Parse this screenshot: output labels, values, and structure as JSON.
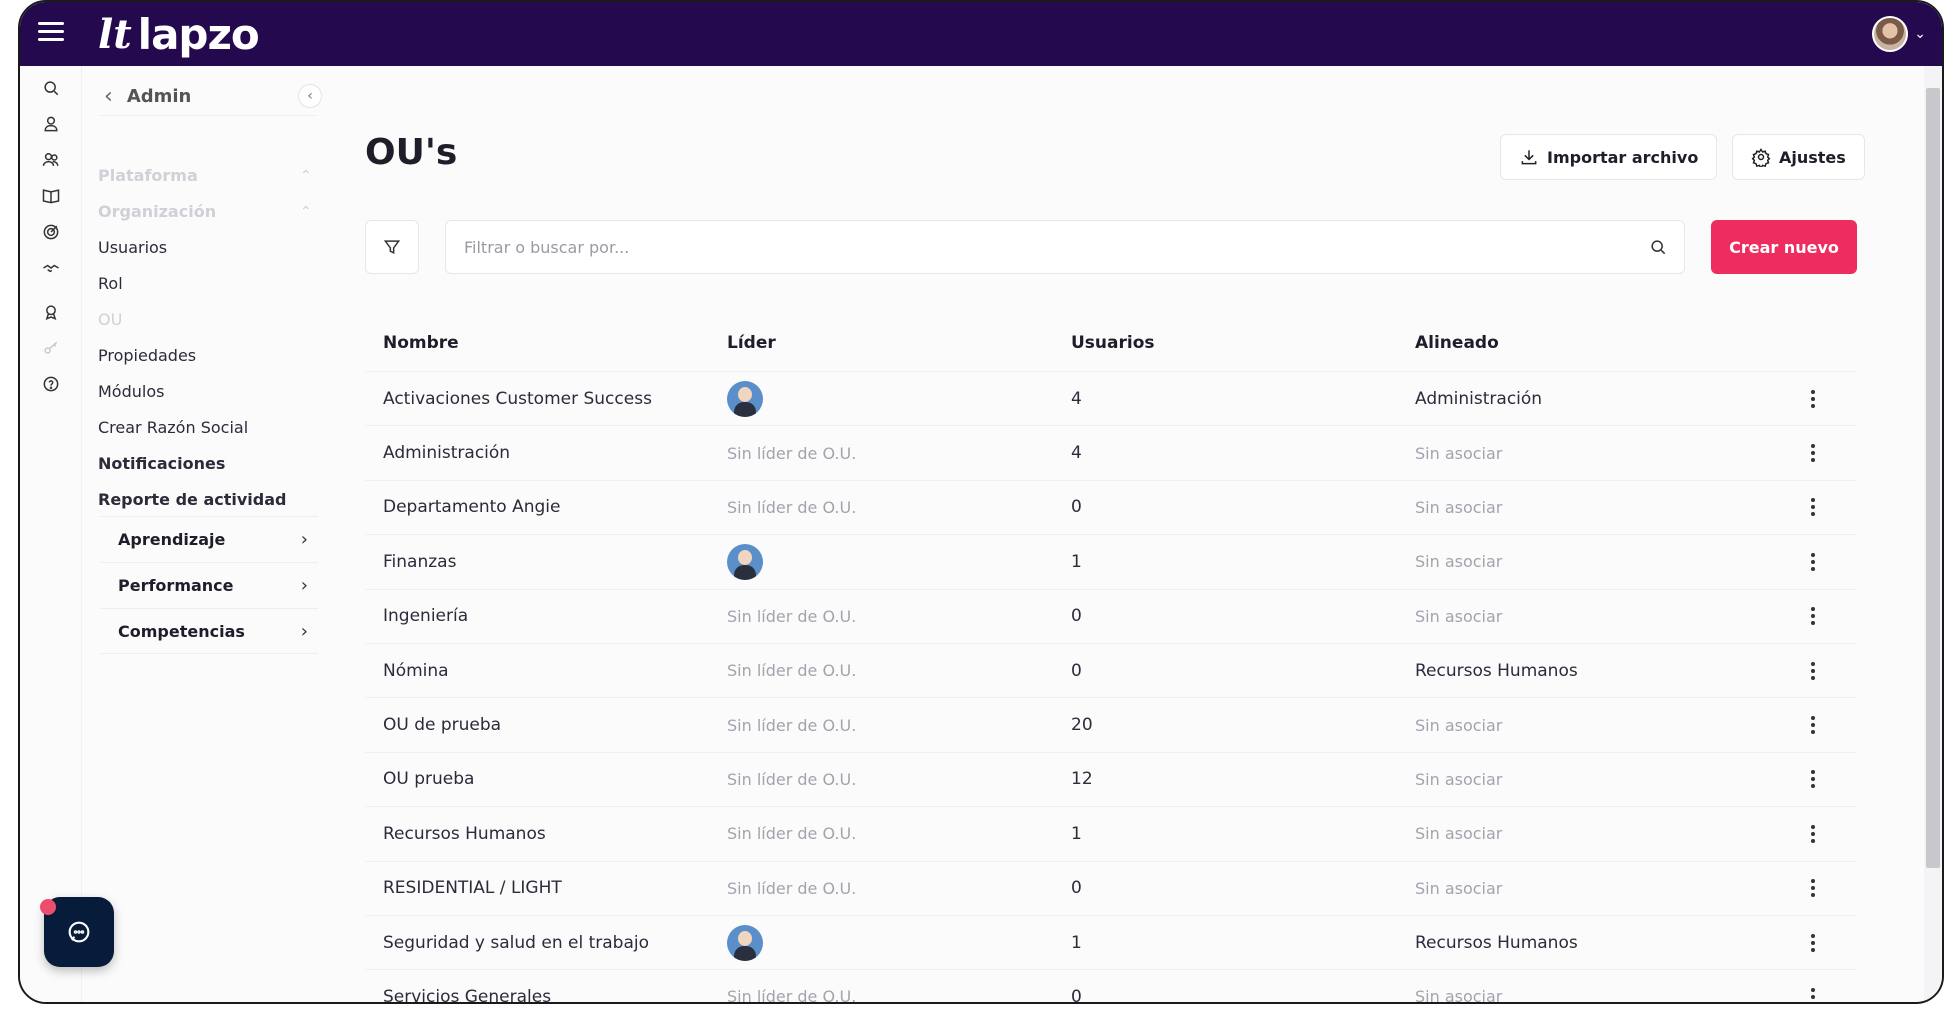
{
  "app": {
    "logo_text": "lapzo",
    "logo_mark": "lt"
  },
  "sidebar": {
    "title": "Admin",
    "sections": [
      {
        "label": "Plataforma",
        "state": "expanded"
      },
      {
        "label": "Organización",
        "state": "expanded"
      }
    ],
    "items": [
      {
        "label": "Usuarios"
      },
      {
        "label": "Rol"
      },
      {
        "label": "OU",
        "active": true
      },
      {
        "label": "Propiedades"
      },
      {
        "label": "Módulos"
      },
      {
        "label": "Crear Razón Social"
      },
      {
        "label": "Notificaciones"
      },
      {
        "label": "Reporte de actividad"
      }
    ],
    "groups": [
      {
        "label": "Aprendizaje"
      },
      {
        "label": "Performance"
      },
      {
        "label": "Competencias"
      }
    ]
  },
  "rail_icons": [
    "search-icon",
    "user-icon",
    "users-icon",
    "book-icon",
    "target-icon",
    "handshake-icon",
    "award-icon",
    "key-icon",
    "help-icon"
  ],
  "page": {
    "title": "OU's",
    "import_label": "Importar archivo",
    "settings_label": "Ajustes",
    "search_placeholder": "Filtrar o buscar por...",
    "create_label": "Crear nuevo"
  },
  "table": {
    "headers": [
      "Nombre",
      "Líder",
      "Usuarios",
      "Alineado"
    ],
    "rows": [
      {
        "name": "Activaciones Customer Success",
        "leader": "",
        "has_leader": true,
        "users": "4",
        "aligned": "Administración",
        "aligned_muted": false
      },
      {
        "name": "Administración",
        "leader": "Sin líder de O.U.",
        "has_leader": false,
        "users": "4",
        "aligned": "Sin asociar",
        "aligned_muted": true
      },
      {
        "name": "Departamento Angie",
        "leader": "Sin líder de O.U.",
        "has_leader": false,
        "users": "0",
        "aligned": "Sin asociar",
        "aligned_muted": true
      },
      {
        "name": "Finanzas",
        "leader": "",
        "has_leader": true,
        "users": "1",
        "aligned": "Sin asociar",
        "aligned_muted": true
      },
      {
        "name": "Ingeniería",
        "leader": "Sin líder de O.U.",
        "has_leader": false,
        "users": "0",
        "aligned": "Sin asociar",
        "aligned_muted": true
      },
      {
        "name": "Nómina",
        "leader": "Sin líder de O.U.",
        "has_leader": false,
        "users": "0",
        "aligned": "Recursos Humanos",
        "aligned_muted": false
      },
      {
        "name": "OU de prueba",
        "leader": "Sin líder de O.U.",
        "has_leader": false,
        "users": "20",
        "aligned": "Sin asociar",
        "aligned_muted": true
      },
      {
        "name": "OU prueba",
        "leader": "Sin líder de O.U.",
        "has_leader": false,
        "users": "12",
        "aligned": "Sin asociar",
        "aligned_muted": true
      },
      {
        "name": "Recursos Humanos",
        "leader": "Sin líder de O.U.",
        "has_leader": false,
        "users": "1",
        "aligned": "Sin asociar",
        "aligned_muted": true
      },
      {
        "name": "RESIDENTIAL / LIGHT",
        "leader": "Sin líder de O.U.",
        "has_leader": false,
        "users": "0",
        "aligned": "Sin asociar",
        "aligned_muted": true
      },
      {
        "name": "Seguridad y salud en el trabajo",
        "leader": "",
        "has_leader": true,
        "users": "1",
        "aligned": "Recursos Humanos",
        "aligned_muted": false
      },
      {
        "name": "Servicios Generales",
        "leader": "Sin líder de O.U.",
        "has_leader": false,
        "users": "0",
        "aligned": "Sin asociar",
        "aligned_muted": true
      }
    ]
  },
  "colors": {
    "topbar": "#24094e",
    "primary": "#ee2c5e",
    "chat": "#071c3b"
  }
}
